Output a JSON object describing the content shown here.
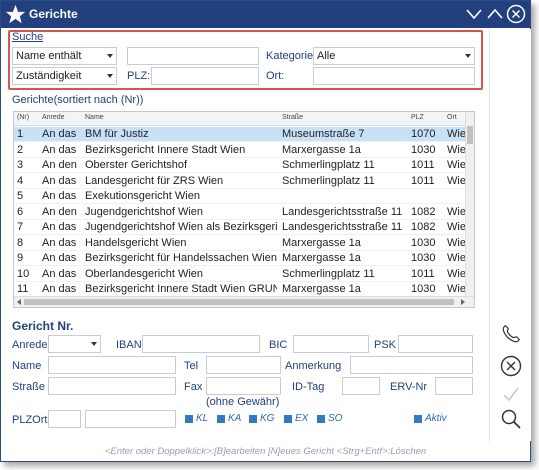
{
  "window": {
    "title": "Gerichte"
  },
  "search": {
    "heading": "Suche",
    "filter1_select": "Name enthält",
    "filter1_value": "",
    "kategorie_label": "Kategorie:",
    "kategorie_select": "Alle",
    "filter2_select": "Zuständigkeit",
    "plz_label": "PLZ:",
    "plz_value": "",
    "ort_label": "Ort:",
    "ort_value": ""
  },
  "grid": {
    "caption": "Gerichte(sortiert nach (Nr))",
    "columns": [
      "(Nr)",
      "Anrede",
      "Name",
      "Straße",
      "PLZ",
      "Ort"
    ],
    "rows": [
      {
        "nr": "1",
        "anrede": "An das",
        "name": "BM für Justiz",
        "strasse": "Museumstraße 7",
        "plz": "1070",
        "ort": "Wie"
      },
      {
        "nr": "2",
        "anrede": "An das",
        "name": "Bezirksgericht Innere Stadt Wien",
        "strasse": "Marxergasse 1a",
        "plz": "1030",
        "ort": "Wie"
      },
      {
        "nr": "3",
        "anrede": "An den",
        "name": "Oberster Gerichtshof",
        "strasse": "Schmerlingplatz 11",
        "plz": "1011",
        "ort": "Wie"
      },
      {
        "nr": "4",
        "anrede": "An das",
        "name": "Landesgericht für ZRS Wien",
        "strasse": "Schmerlingplatz 11",
        "plz": "1011",
        "ort": "Wie"
      },
      {
        "nr": "5",
        "anrede": "An das",
        "name": "Exekutionsgericht Wien",
        "strasse": "",
        "plz": "",
        "ort": ""
      },
      {
        "nr": "6",
        "anrede": "An den",
        "name": "Jugendgerichtshof Wien",
        "strasse": "Landesgerichtsstraße 11",
        "plz": "1082",
        "ort": "Wie"
      },
      {
        "nr": "7",
        "anrede": "An das",
        "name": "Jugendgerichtshof Wien als Bezirksgeric...",
        "strasse": "Landesgerichtsstraße 11",
        "plz": "1082",
        "ort": "Wie"
      },
      {
        "nr": "8",
        "anrede": "An das",
        "name": "Handelsgericht Wien",
        "strasse": "Marxergasse 1a",
        "plz": "1030",
        "ort": "Wie"
      },
      {
        "nr": "9",
        "anrede": "An das",
        "name": "Bezirksgericht für Handelssachen Wien",
        "strasse": "Marxergasse 1a",
        "plz": "1030",
        "ort": "Wie"
      },
      {
        "nr": "10",
        "anrede": "An das",
        "name": "Oberlandesgericht Wien",
        "strasse": "Schmerlingplatz 11",
        "plz": "1011",
        "ort": "Wie"
      },
      {
        "nr": "11",
        "anrede": "An das",
        "name": "Bezirksgericht Innere Stadt Wien GRUN...",
        "strasse": "Marxergasse 1a",
        "plz": "1030",
        "ort": "Wie"
      }
    ]
  },
  "detail": {
    "heading": "Gericht Nr.",
    "anrede_label": "Anrede",
    "iban_label": "IBAN",
    "bic_label": "BIC",
    "psk_label": "PSK",
    "name_label": "Name",
    "tel_label": "Tel",
    "anmerkung_label": "Anmerkung",
    "strasse_label": "Straße",
    "fax_label": "Fax",
    "idtag_label": "ID-Tag",
    "ervnr_label": "ERV-Nr",
    "gewaehr_label": "(ohne Gewähr)",
    "plzort_label": "PLZOrt",
    "checkboxes": [
      "KL",
      "KA",
      "KG",
      "EX",
      "SO"
    ],
    "aktiv_label": "Aktiv"
  },
  "hint": "<Enter oder Doppelklick>:[B]earbeiten  [N]eues Gericht  <Strg+Entf>:Löschen",
  "icons": [
    "phone-icon",
    "cancel-circle-icon",
    "check-icon",
    "search-icon"
  ]
}
